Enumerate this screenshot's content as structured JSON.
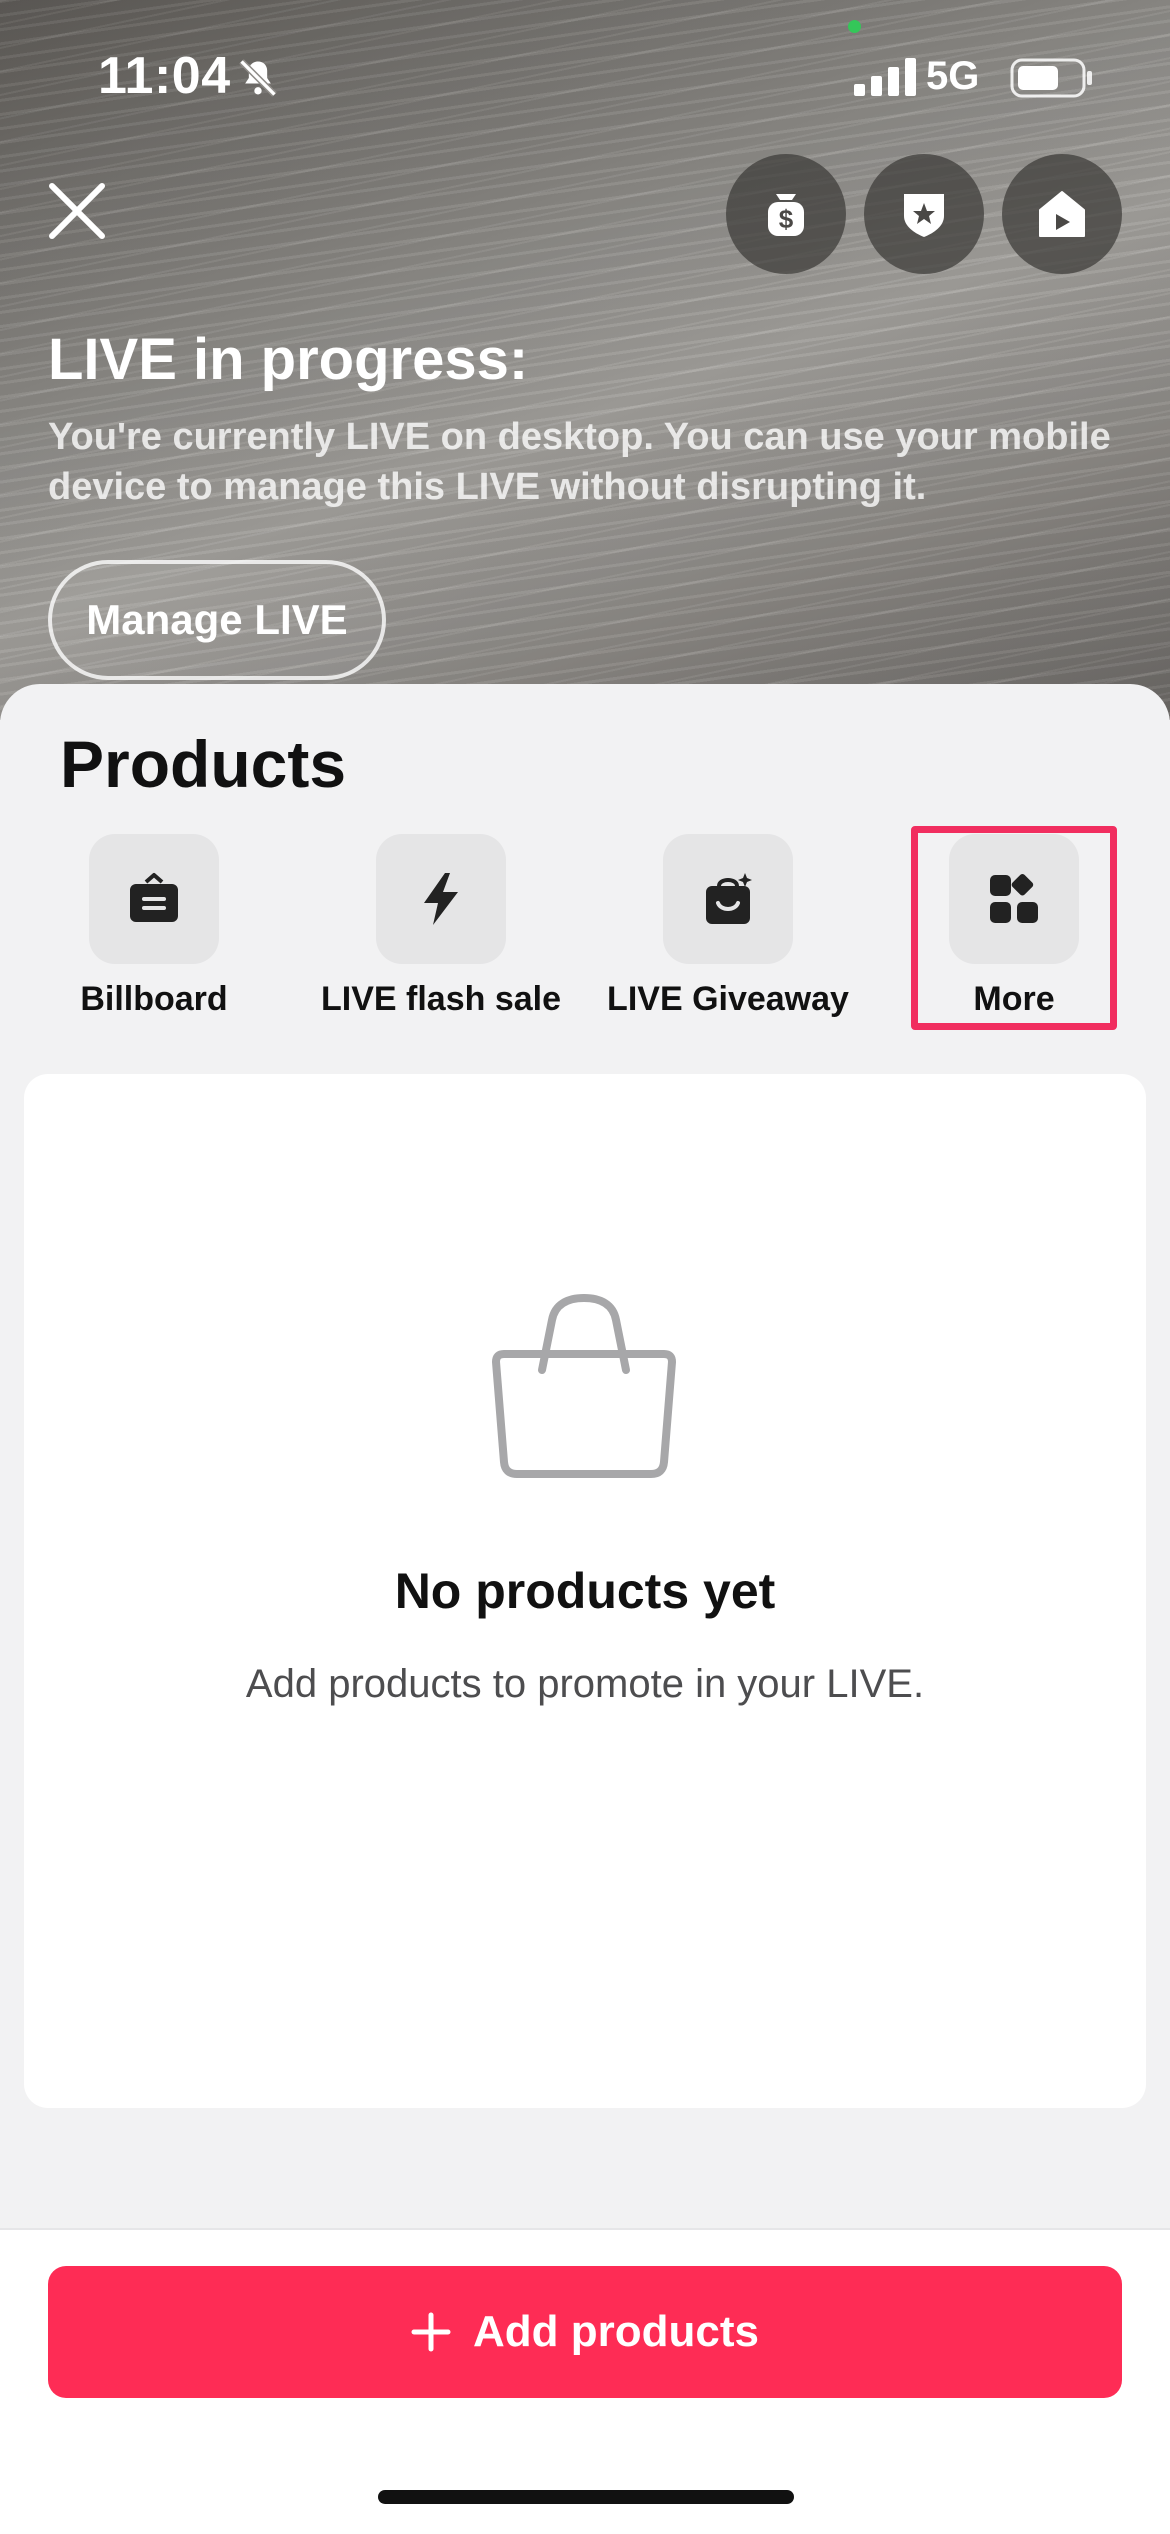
{
  "status_bar": {
    "time": "11:04",
    "network": "5G",
    "icons": [
      "bell-off-icon",
      "signal-icon",
      "battery-icon"
    ]
  },
  "header": {
    "close_icon": "close-icon",
    "actions": [
      {
        "name": "dollar-bag-icon"
      },
      {
        "name": "shield-star-icon"
      },
      {
        "name": "live-home-icon"
      }
    ]
  },
  "live_banner": {
    "title": "LIVE in progress:",
    "description": "You're currently LIVE on desktop. You can use your mobile device to manage this LIVE without disrupting it.",
    "manage_label": "Manage LIVE"
  },
  "products": {
    "title": "Products",
    "tools": [
      {
        "label": "Billboard",
        "icon": "billboard-icon"
      },
      {
        "label": "LIVE flash sale",
        "icon": "lightning-icon"
      },
      {
        "label": "LIVE Giveaway",
        "icon": "gift-bag-icon"
      },
      {
        "label": "More",
        "icon": "grid-icon"
      }
    ],
    "highlighted_tool": "More"
  },
  "empty_state": {
    "icon": "shopping-bag-icon",
    "title": "No products yet",
    "subtitle": "Add products to promote in your LIVE."
  },
  "footer": {
    "add_label": "Add products"
  },
  "colors": {
    "accent": "#fe2c55",
    "highlight": "#f12e5f",
    "sheet_bg": "#f2f2f3"
  }
}
